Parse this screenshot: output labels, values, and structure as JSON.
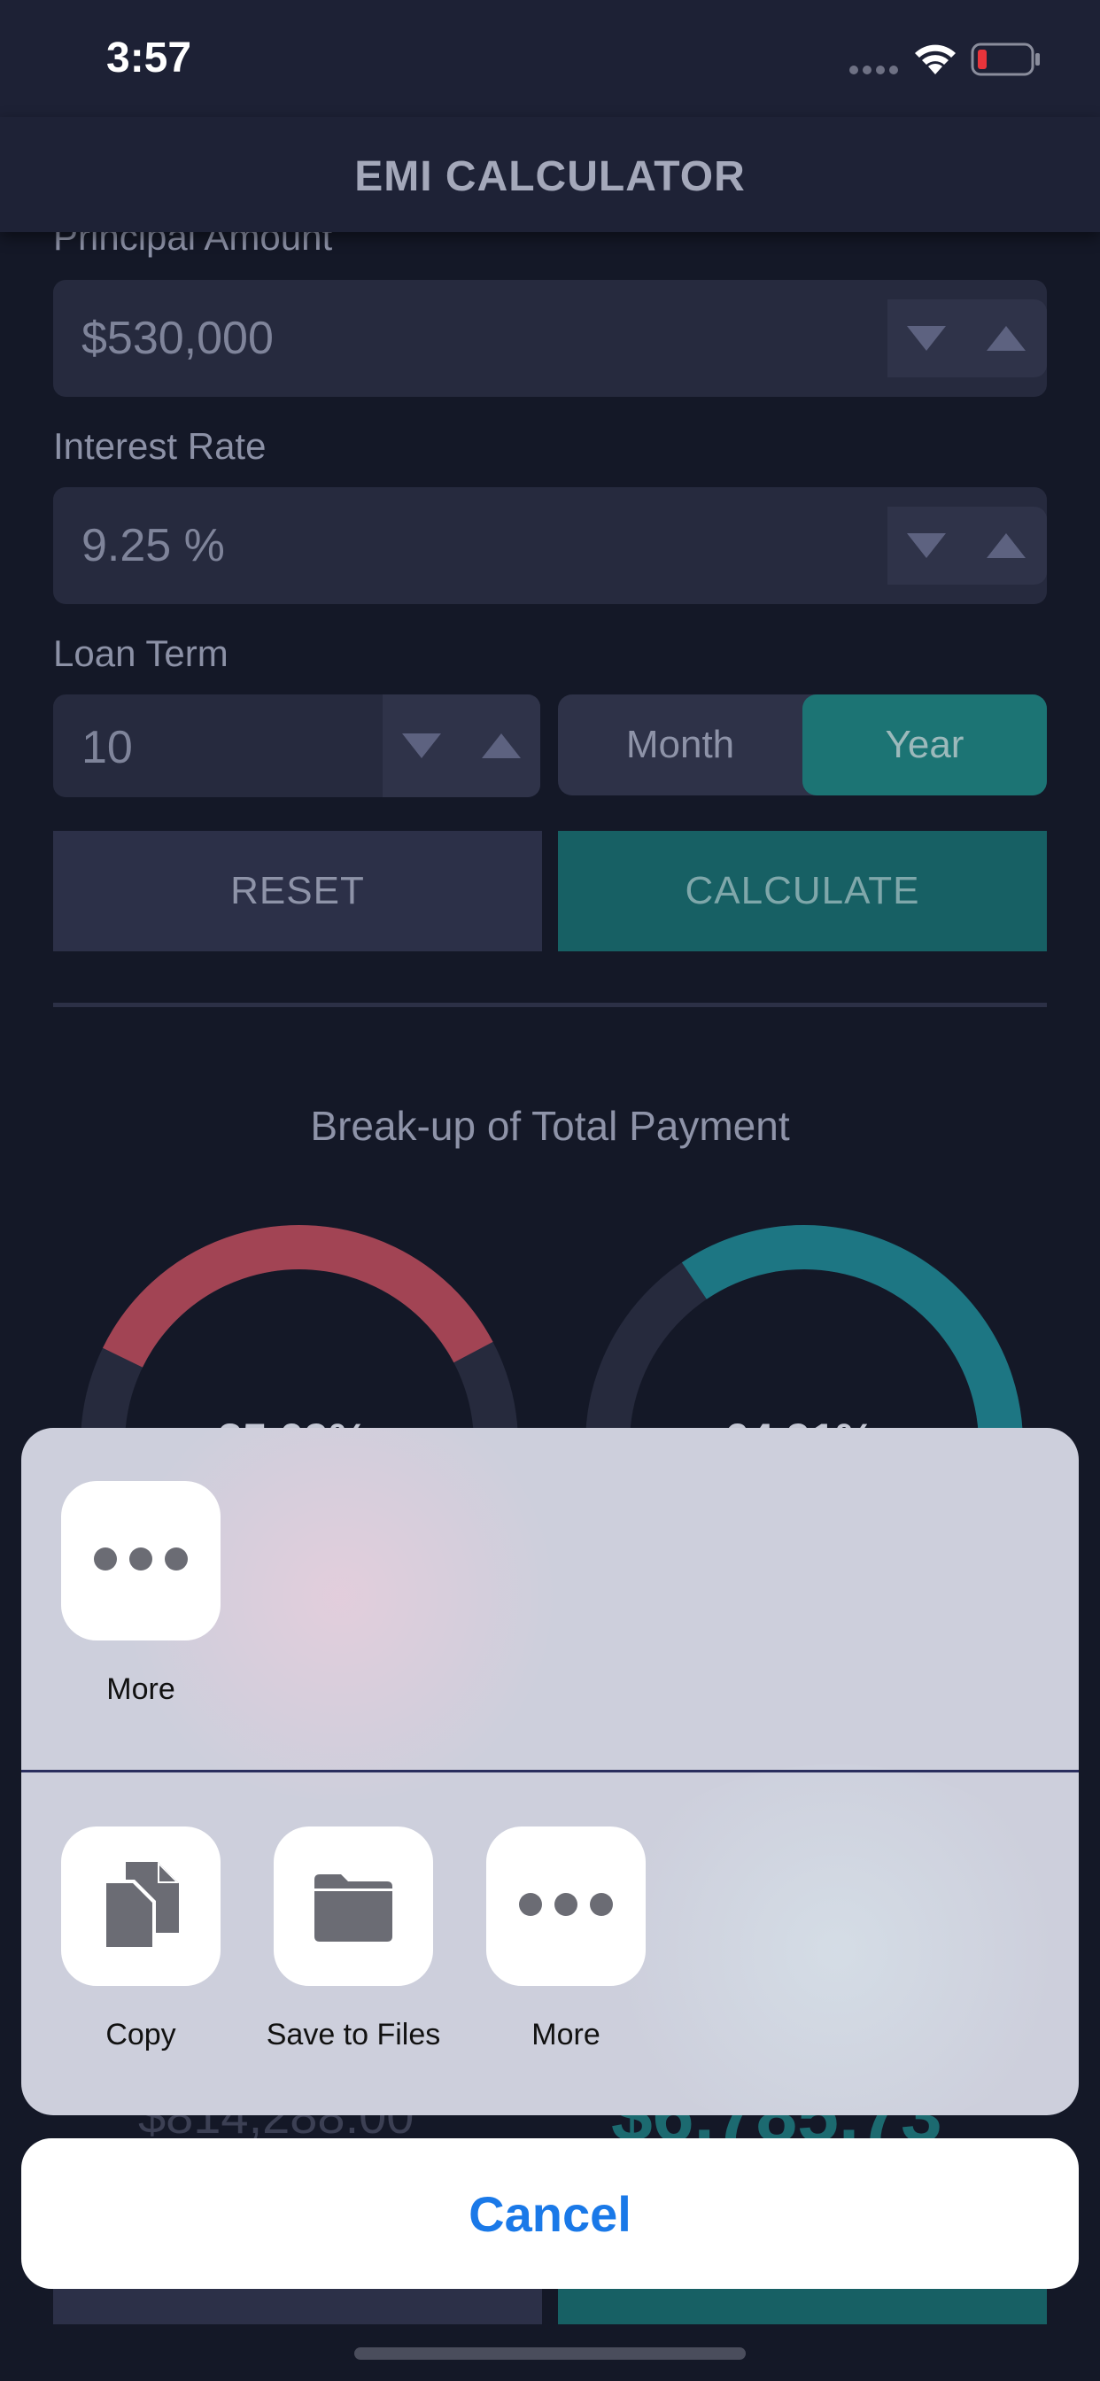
{
  "status_bar": {
    "time": "3:57"
  },
  "nav": {
    "title": "EMI CALCULATOR"
  },
  "form": {
    "principal": {
      "label": "Principal Amount",
      "value": "$530,000"
    },
    "interest": {
      "label": "Interest Rate",
      "value": "9.25 %"
    },
    "loan_term": {
      "label": "Loan Term",
      "value": "10",
      "unit_options": [
        "Month",
        "Year"
      ],
      "selected_unit": "Year"
    },
    "reset_label": "RESET",
    "calculate_label": "CALCULATE"
  },
  "results": {
    "chart_title": "Break-up of Total Payment",
    "left_pct_partial": "35.09%",
    "right_pct_partial": "64.91%",
    "left_total_partial": "$814,288.00",
    "right_emi_partial": "$6,785.73"
  },
  "share_sheet": {
    "top_row": [
      {
        "label": "More",
        "icon": "more-icon"
      }
    ],
    "actions": [
      {
        "label": "Copy",
        "icon": "copy-icon"
      },
      {
        "label": "Save to Files",
        "icon": "folder-icon"
      },
      {
        "label": "More",
        "icon": "more-icon"
      }
    ],
    "cancel_label": "Cancel"
  },
  "colors": {
    "background": "#141827",
    "accent_teal": "#1c7474",
    "donut_red": "#a24454",
    "donut_teal": "#1d7683",
    "link_blue": "#1a79e8"
  }
}
